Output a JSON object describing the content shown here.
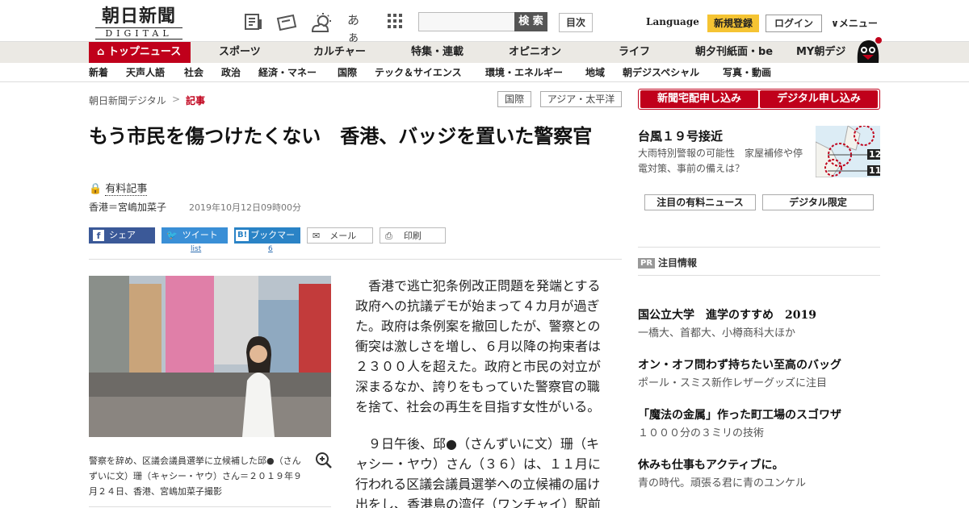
{
  "header": {
    "logo_top": "朝日新聞",
    "logo_bottom": "DIGITAL",
    "font_toggle": "あぁ",
    "search_button": "検 索",
    "toc_button": "目次",
    "language": "Language",
    "register": "新規登録",
    "login": "ログイン",
    "menu": "メニュー"
  },
  "nav_primary": [
    "トップニュース",
    "スポーツ",
    "カルチャー",
    "特集・連載",
    "オピニオン",
    "ライフ",
    "朝夕刊紙面・be",
    "MY朝デジ"
  ],
  "nav_secondary": [
    "新着",
    "天声人語",
    "社会",
    "政治",
    "経済・マネー",
    "国際",
    "テック＆サイエンス",
    "環境・エネルギー",
    "地域",
    "朝デジスペシャル",
    "写真・動画"
  ],
  "breadcrumb": {
    "home": "朝日新聞デジタル",
    "sep": ">",
    "current": "記事"
  },
  "tags": [
    "国際",
    "アジア・太平洋"
  ],
  "article": {
    "title": "もう市民を傷つけたくない　香港、バッジを置いた警察官",
    "paid_label": "有料記事",
    "byline": "香港＝宮嶋加菜子",
    "date": "2019年10月12日09時00分",
    "share": {
      "facebook": "シェア",
      "twitter": "ツイート",
      "twitter_count": "list",
      "hatena": "ブックマーク",
      "hatena_count": "6",
      "mail": "メール",
      "print": "印刷"
    },
    "caption": "警察を辞め、区議会議員選挙に立候補した邱●（さんずいに文）珊（キャシー・ヤウ）さん＝２０１９年９月２４日、香港、宮嶋加菜子撮影",
    "paragraphs": [
      "香港で逃亡犯条例改正問題を発端とする政府への抗議デモが始まって４カ月が過ぎた。政府は条例案を撤回したが、警察との衝突は激しさを増し、６月以降の拘束者は２３００人を超えた。政府と市民の対立が深まるなか、誇りをもっていた警察官の職を捨て、社会の再生を目指す女性がいる。",
      "９日午後、邱●（さんずいに文）珊（キャシー・ヤウ）さん（３６）は、１１月に行われる区議会議員選挙への立候補の届け出をし、香港島の湾仔（ワンチャイ）駅前"
    ]
  },
  "sidebar": {
    "subscribe_paper": "新聞宅配申し込み",
    "subscribe_digital": "デジタル申し込み",
    "typhoon_title": "台風１９号接近",
    "typhoon_sub": "大雨特別警報の可能性　家屋補修や停電対策、事前の備えは？",
    "map_labels": [
      "12",
      "11"
    ],
    "tab_paid": "注目の有料ニュース",
    "tab_digital": "デジタル限定",
    "pr_badge": "PR",
    "pr_title": "注目情報",
    "ads": [
      {
        "title": "国公立大学　進学のすすめ　2019",
        "sub": "一橋大、首都大、小樽商科大ほか"
      },
      {
        "title": "オン・オフ問わず持ちたい至高のバッグ",
        "sub": "ポール・スミス新作レザーグッズに注目"
      },
      {
        "title": "「魔法の金属」作った町工場のスゴワザ",
        "sub": "１０００分の３ミリの技術"
      },
      {
        "title": "休みも仕事もアクティブに。",
        "sub": "青の時代。頑張る君に青のユンケル"
      }
    ]
  }
}
